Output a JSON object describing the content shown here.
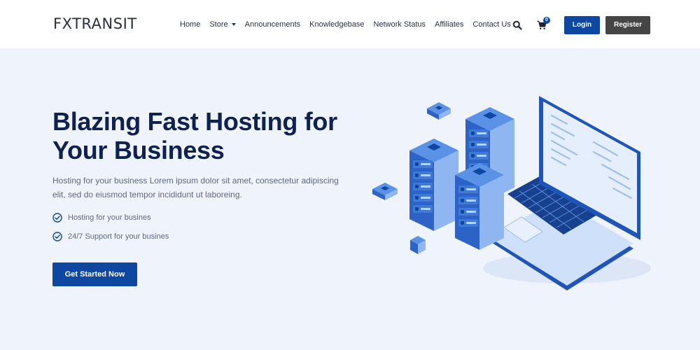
{
  "brand": {
    "logo_text": "FXTRANSIT"
  },
  "nav": {
    "items": [
      {
        "label": "Home"
      },
      {
        "label": "Store"
      },
      {
        "label": "Announcements"
      },
      {
        "label": "Knowledgebase"
      },
      {
        "label": "Network Status"
      },
      {
        "label": "Affiliates"
      },
      {
        "label": "Contact Us"
      }
    ],
    "cart_count": "0",
    "login_label": "Login",
    "register_label": "Register"
  },
  "hero": {
    "title": "Blazing Fast Hosting for Your Business",
    "description": "Hosting for your business Lorem ipsum dolor sit amet, consectetur adipiscing elit, sed do eiusmod tempor incididunt ut laboreing.",
    "features": [
      "Hosting for your busines",
      "24/7 Support for your busines"
    ],
    "cta_label": "Get Started Now"
  },
  "colors": {
    "primary": "#0d47a1",
    "dark_button": "#454545",
    "heading": "#0f2150",
    "page_background": "#eff3fc"
  },
  "icons": [
    "search-icon",
    "cart-icon",
    "check-circle-icon"
  ]
}
